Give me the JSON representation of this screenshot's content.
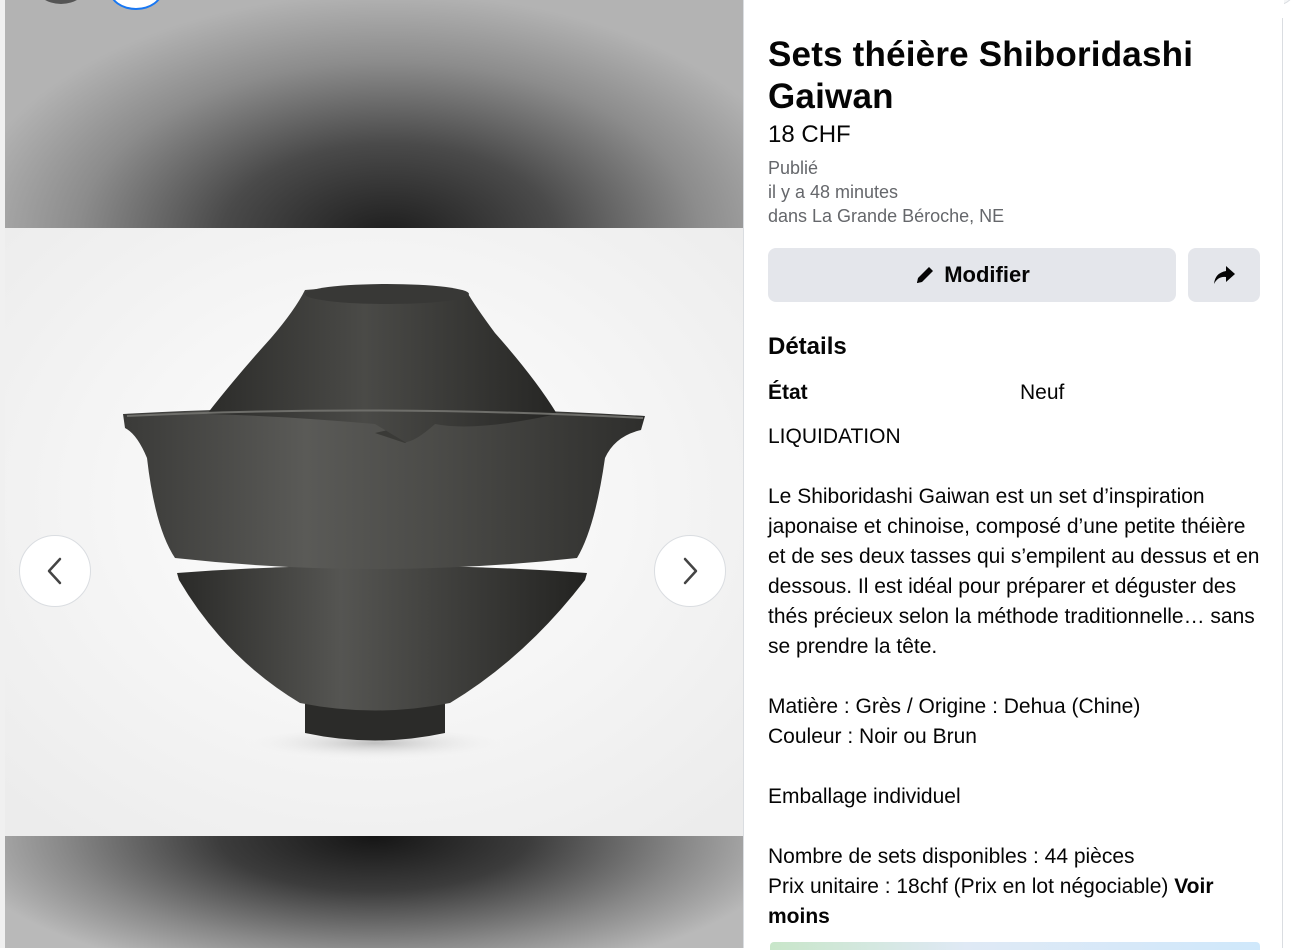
{
  "listing": {
    "title": "Sets théière Shiboridashi Gaiwan",
    "price": "18 CHF",
    "published_label": "Publié",
    "published_time": "il y a 48 minutes",
    "location": "dans La Grande Béroche, NE"
  },
  "actions": {
    "edit_label": "Modifier",
    "edit_icon": "pencil-icon",
    "share_icon": "share-icon"
  },
  "details": {
    "heading": "Détails",
    "condition_label": "État",
    "condition_value": "Neuf",
    "description": "LIQUIDATION\n\nLe Shiboridashi Gaiwan est un set d’inspiration japonaise et chinoise, composé d’une petite théière et de ses deux tasses qui s’empilent au dessus et en dessous. Il est idéal pour préparer et déguster des thés précieux selon la méthode traditionnelle… sans se prendre la tête.\n\nMatière : Grès / Origine : Dehua (Chine)\nCouleur : Noir ou Brun\n\nEmballage individuel\n\nNombre de sets disponibles : 44 pièces\nPrix unitaire : 18chf (Prix en lot négociable) ",
    "see_less": "Voir moins"
  },
  "media": {
    "prev_icon": "chevron-left-icon",
    "next_icon": "chevron-right-icon"
  }
}
